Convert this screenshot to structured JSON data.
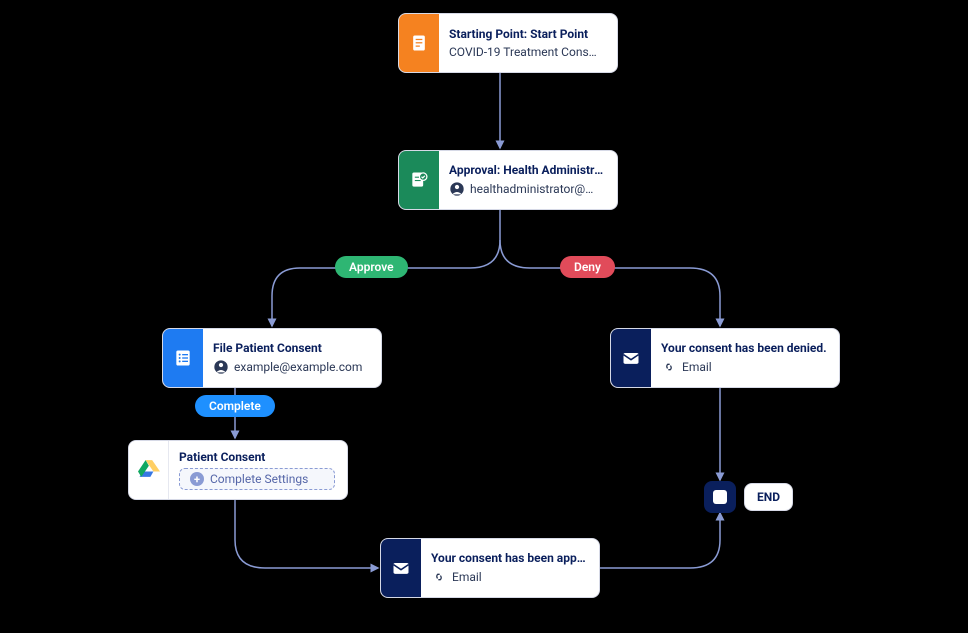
{
  "nodes": {
    "start": {
      "title": "Starting Point: Start Point",
      "subtitle": "COVID-19 Treatment Cons…",
      "iconColor": "#f58220"
    },
    "approval": {
      "title": "Approval: Health Administrat…",
      "subtitle": "healthadministrator@…",
      "iconColor": "#1b8a5a"
    },
    "fileConsent": {
      "title": "File Patient Consent",
      "subtitle": "example@example.com",
      "iconColor": "#1e7bf2"
    },
    "denied": {
      "title": "Your consent has been denied.",
      "subtitle": "Email",
      "iconColor": "#0a1f5c"
    },
    "patientConsent": {
      "title": "Patient Consent",
      "settings": "Complete Settings"
    },
    "approved": {
      "title": "Your consent has been appro…",
      "subtitle": "Email",
      "iconColor": "#0a1f5c"
    },
    "end": {
      "label": "END"
    }
  },
  "pills": {
    "approve": "Approve",
    "deny": "Deny",
    "complete": "Complete"
  },
  "colors": {
    "connector": "#8a9bd4",
    "arrowFill": "#8a9bd4"
  }
}
